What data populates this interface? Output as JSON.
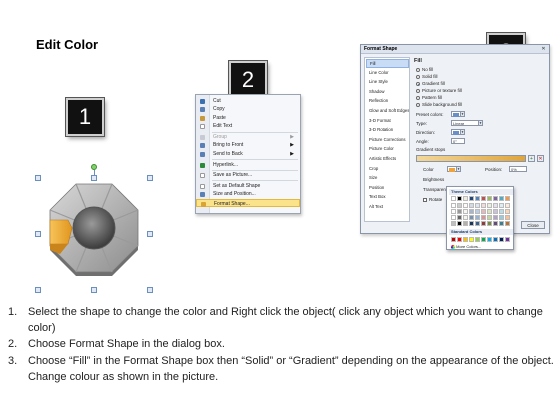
{
  "title": "Edit Color",
  "steps": [
    {
      "num": "1"
    },
    {
      "num": "2"
    },
    {
      "num": "3"
    }
  ],
  "context_menu": {
    "items": [
      {
        "label": "Cut",
        "icon": "scissors-icon",
        "icon_color": "#3a6fb0"
      },
      {
        "label": "Copy",
        "icon": "copy-icon",
        "icon_color": "#5a7fb5"
      },
      {
        "label": "Paste",
        "icon": "paste-icon",
        "icon_color": "#c8993a"
      },
      {
        "label": "Edit Text",
        "icon": "edit-text-icon",
        "icon_color": "#ffffff"
      },
      {
        "label": "Group",
        "icon": "group-icon",
        "icon_color": "#9aa3b1",
        "arrow": "▶",
        "disabled": true
      },
      {
        "label": "Bring to Front",
        "icon": "bring-front-icon",
        "icon_color": "#5a7fb5",
        "arrow": "▶"
      },
      {
        "label": "Send to Back",
        "icon": "send-back-icon",
        "icon_color": "#5a7fb5",
        "arrow": "▶"
      },
      {
        "label": "Hyperlink...",
        "icon": "hyperlink-icon",
        "icon_color": "#2a8a3a"
      },
      {
        "label": "Save as Picture...",
        "icon": "picture-icon",
        "icon_color": "#ffffff"
      },
      {
        "label": "Set as Default Shape",
        "icon": "default-shape-icon",
        "icon_color": "#ffffff"
      },
      {
        "label": "Size and Position...",
        "icon": "size-icon",
        "icon_color": "#5a7fb5"
      },
      {
        "label": "Format Shape...",
        "icon": "format-shape-icon",
        "icon_color": "#d9a431",
        "highlighted": true
      }
    ]
  },
  "dialog": {
    "title": "Format Shape",
    "close": "✕",
    "categories": [
      "Fill",
      "Line Color",
      "Line Style",
      "Shadow",
      "Reflection",
      "Glow and Soft Edges",
      "3-D Format",
      "3-D Rotation",
      "Picture Corrections",
      "Picture Color",
      "Artistic Effects",
      "Crop",
      "Size",
      "Position",
      "Text Box",
      "Alt Text"
    ],
    "selected_category": "Fill",
    "section": "Fill",
    "fill_options": [
      {
        "label": "No fill",
        "checked": false
      },
      {
        "label": "Solid fill",
        "checked": false
      },
      {
        "label": "Gradient fill",
        "checked": true
      },
      {
        "label": "Picture or texture fill",
        "checked": false
      },
      {
        "label": "Pattern fill",
        "checked": false
      },
      {
        "label": "Slide background fill",
        "checked": false
      }
    ],
    "preset_colors_label": "Preset colors:",
    "type_label": "Type:",
    "type_value": "Linear",
    "direction_label": "Direction:",
    "angle_label": "Angle:",
    "angle_value": "0°",
    "gradient_stops_label": "Gradient stops",
    "color_label": "Color",
    "position_label": "Position:",
    "position_value": "0%",
    "brightness_label": "Brightness",
    "transparency_label": "Transparen",
    "rotate_label": "Rotate",
    "close_button": "Close",
    "add_stop": "+",
    "remove_stop": "✕"
  },
  "palette": {
    "theme_header": "Theme Colors",
    "standard_header": "Standard Colors",
    "more_colors": "More Colors...",
    "theme_top": [
      "#ffffff",
      "#000000",
      "#eeece1",
      "#1f497d",
      "#4f81bd",
      "#c0504d",
      "#9bbb59",
      "#8064a2",
      "#4bacc6",
      "#f79646"
    ],
    "standard": [
      "#c00000",
      "#ff0000",
      "#ffc000",
      "#ffff00",
      "#92d050",
      "#00b050",
      "#00b0f0",
      "#0070c0",
      "#002060",
      "#7030a0"
    ]
  },
  "instructions": [
    {
      "num": "1.",
      "text": "Select the shape to change the color and Right click the object( click any object which you want to change color)"
    },
    {
      "num": "2.",
      "text": "Choose Format Shape in the dialog box."
    },
    {
      "num": "3.",
      "text": "Choose “Fill” in the Format Shape box then “Solid” or “Gradient” depending on the appearance of the object. Change colour as shown in the picture."
    }
  ]
}
